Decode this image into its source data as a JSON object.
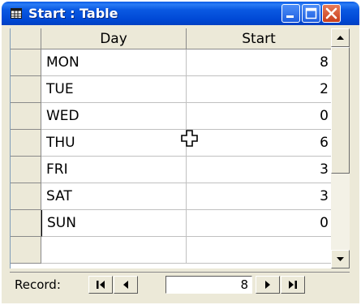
{
  "window": {
    "title": "Start : Table",
    "icons": {
      "title": "table-icon",
      "minimize": "minimize-icon",
      "maximize": "maximize-icon",
      "close": "close-icon"
    }
  },
  "table": {
    "columns": [
      "Day",
      "Start"
    ],
    "rows": [
      {
        "day": "MON",
        "start": "8"
      },
      {
        "day": "TUE",
        "start": "2"
      },
      {
        "day": "WED",
        "start": "0"
      },
      {
        "day": "THU",
        "start": "6"
      },
      {
        "day": "FRI",
        "start": "3"
      },
      {
        "day": "SAT",
        "start": "3"
      },
      {
        "day": "SUN",
        "start": "0"
      }
    ]
  },
  "navigation": {
    "label": "Record:",
    "record_number": "8",
    "icons": {
      "first": "first-record-icon",
      "prev": "previous-record-icon",
      "next": "next-record-icon",
      "last": "last-record-icon"
    }
  },
  "cursor": "crosshair-plus-icon"
}
